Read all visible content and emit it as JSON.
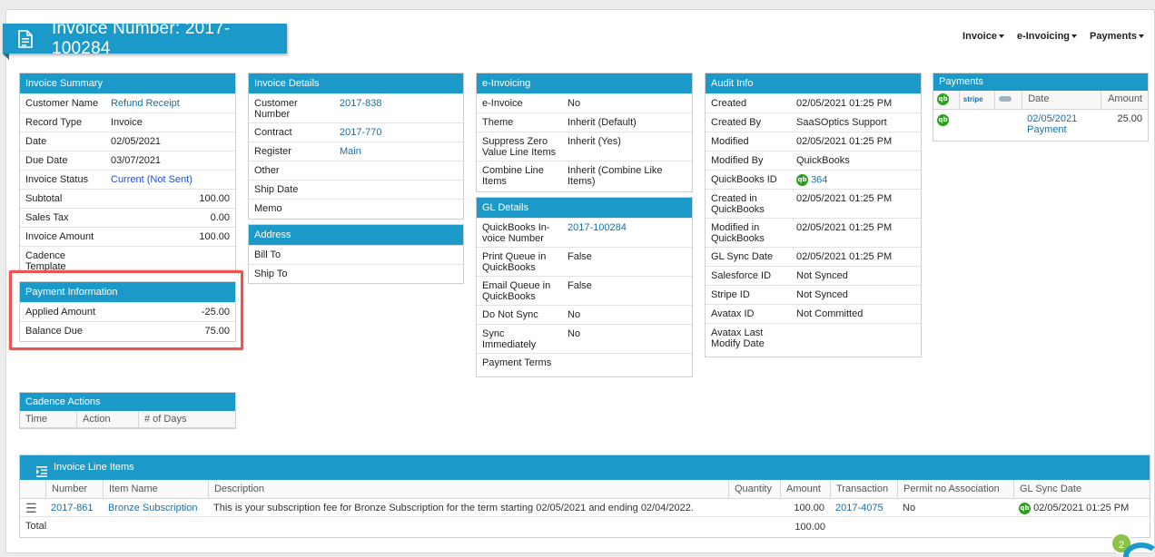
{
  "header": {
    "title": "Invoice Number: 2017-100284",
    "menu": [
      "Invoice",
      "e-Invoicing",
      "Payments"
    ]
  },
  "invoice_summary": {
    "title": "Invoice Summary",
    "rows": [
      {
        "label": "Customer Name",
        "value": "Refund Receipt"
      },
      {
        "label": "Record Type",
        "value": "Invoice"
      },
      {
        "label": "Date",
        "value": "02/05/2021"
      },
      {
        "label": "Due Date",
        "value": "03/07/2021"
      },
      {
        "label": "Invoice Status",
        "value": "Current (Not Sent)"
      },
      {
        "label": "Subtotal",
        "value": "100.00"
      },
      {
        "label": "Sales Tax",
        "value": "0.00"
      },
      {
        "label": "Invoice Amount",
        "value": "100.00"
      },
      {
        "label": "Cadence Template",
        "value": ""
      }
    ]
  },
  "payment_information": {
    "title": "Payment Information",
    "rows": [
      {
        "label": "Applied Amount",
        "value": "-25.00"
      },
      {
        "label": "Balance Due",
        "value": "75.00"
      }
    ]
  },
  "cadence_actions": {
    "title": "Cadence Actions",
    "columns": [
      "Time",
      "Action",
      "# of Days"
    ]
  },
  "invoice_details": {
    "title": "Invoice Details",
    "rows": [
      {
        "label": "Customer Number",
        "value": "2017-838"
      },
      {
        "label": "Contract",
        "value": "2017-770"
      },
      {
        "label": "Register",
        "value": "Main"
      },
      {
        "label": "Other",
        "value": ""
      },
      {
        "label": "Ship Date",
        "value": ""
      },
      {
        "label": "Memo",
        "value": ""
      }
    ]
  },
  "address": {
    "title": "Address",
    "rows": [
      {
        "label": "Bill To",
        "value": ""
      },
      {
        "label": "Ship To",
        "value": ""
      }
    ]
  },
  "e_invoicing": {
    "title": "e-Invoicing",
    "rows": [
      {
        "label": "e-Invoice",
        "value": "No"
      },
      {
        "label": "Theme",
        "value": "Inherit (Default)"
      },
      {
        "label": "Suppress Zero Value Line Items",
        "value": "Inherit (Yes)"
      },
      {
        "label": "Combine Line Items",
        "value": "Inherit (Combine Like Items)"
      }
    ]
  },
  "gl_details": {
    "title": "GL Details",
    "rows": [
      {
        "label": "QuickBooks In-voice Number",
        "value": "2017-100284"
      },
      {
        "label": "Print Queue in QuickBooks",
        "value": "False"
      },
      {
        "label": "Email Queue in QuickBooks",
        "value": "False"
      },
      {
        "label": "Do Not Sync",
        "value": "No"
      },
      {
        "label": "Sync Immediately",
        "value": "No"
      },
      {
        "label": "Payment Terms",
        "value": ""
      }
    ]
  },
  "audit_info": {
    "title": "Audit Info",
    "rows": [
      {
        "label": "Created",
        "value": "02/05/2021 01:25 PM"
      },
      {
        "label": "Created By",
        "value": "SaaSOptics Support"
      },
      {
        "label": "Modified",
        "value": "02/05/2021 01:25 PM"
      },
      {
        "label": "Modified By",
        "value": "QuickBooks"
      },
      {
        "label": "QuickBooks ID",
        "value": "364"
      },
      {
        "label": "Created in QuickBooks",
        "value": "02/05/2021 01:25 PM"
      },
      {
        "label": "Modified in QuickBooks",
        "value": "02/05/2021 01:25 PM"
      },
      {
        "label": "GL Sync Date",
        "value": "02/05/2021 01:25 PM"
      },
      {
        "label": "Salesforce ID",
        "value": "Not Synced"
      },
      {
        "label": "Stripe ID",
        "value": "Not Synced"
      },
      {
        "label": "Avatax ID",
        "value": "Not Committed"
      },
      {
        "label": "Avatax Last Modify Date",
        "value": ""
      }
    ]
  },
  "payments": {
    "title": "Payments",
    "col_stripe": "stripe",
    "col_date": "Date",
    "col_amount": "Amount",
    "row": {
      "date": "02/05/2021",
      "type": "Payment",
      "amount": "25.00"
    }
  },
  "line_items": {
    "title": "Invoice Line Items",
    "columns": [
      "Number",
      "Item Name",
      "Description",
      "Quantity",
      "Amount",
      "Transaction",
      "Permit no Association",
      "GL Sync Date"
    ],
    "rows": [
      {
        "number": "2017-861",
        "item_name": "Bronze Subscription",
        "description": "This is your subscription fee for Bronze Subscription for the term starting 02/05/2021 and ending 02/04/2022.",
        "quantity": "",
        "amount": "100.00",
        "transaction": "2017-4075",
        "permit": "No",
        "gl_sync_date": "02/05/2021 01:25 PM"
      }
    ],
    "total_label": "Total",
    "total_amount": "100.00"
  },
  "notification_badge": "2",
  "qb_glyph": "qb",
  "colors": {
    "header_blue": "#1b9ac9",
    "link": "#1a6fa8",
    "highlight": "#ef5350",
    "quickbooks_green": "#2ca01c"
  }
}
